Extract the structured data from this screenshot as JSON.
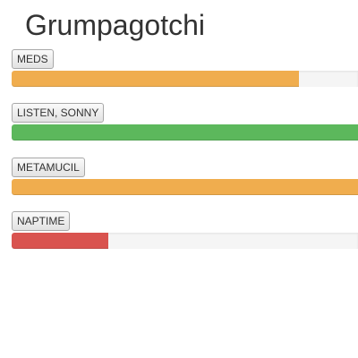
{
  "app": {
    "title": "Grumpagotchi"
  },
  "stats": [
    {
      "label": "MEDS",
      "level": 0.83,
      "color": "#f0ad4e"
    },
    {
      "label": "LISTEN, SONNY",
      "level": 1.0,
      "color": "#5cb85c"
    },
    {
      "label": "METAMUCIL",
      "level": 1.0,
      "color": "#f0ad4e"
    },
    {
      "label": "NAPTIME",
      "level": 0.28,
      "color": "#d9534f"
    }
  ]
}
